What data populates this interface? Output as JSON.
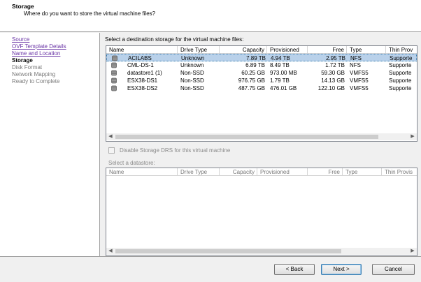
{
  "header": {
    "title": "Storage",
    "subtitle": "Where do you want to store the virtual machine files?"
  },
  "nav": {
    "items": [
      {
        "label": "Source",
        "state": "link"
      },
      {
        "label": "OVF Template Details",
        "state": "link"
      },
      {
        "label": "Name and Location",
        "state": "link"
      },
      {
        "label": "Storage",
        "state": "current"
      },
      {
        "label": "Disk Format",
        "state": "disabled"
      },
      {
        "label": "Network Mapping",
        "state": "disabled"
      },
      {
        "label": "Ready to Complete",
        "state": "disabled"
      }
    ]
  },
  "main": {
    "prompt": "Select a destination storage for the virtual machine files:",
    "columns": [
      "Name",
      "Drive Type",
      "Capacity",
      "Provisioned",
      "Free",
      "Type",
      "Thin Prov"
    ],
    "rows": [
      {
        "name": "ACILABS",
        "drive": "Unknown",
        "capacity": "7.89 TB",
        "provisioned": "4.94 TB",
        "free": "2.95 TB",
        "type": "NFS",
        "thin": "Supporte",
        "selected": true
      },
      {
        "name": "CML-DS-1",
        "drive": "Unknown",
        "capacity": "6.89 TB",
        "provisioned": "8.49 TB",
        "free": "1.72 TB",
        "type": "NFS",
        "thin": "Supporte",
        "selected": false
      },
      {
        "name": "datastore1 (1)",
        "drive": "Non-SSD",
        "capacity": "60.25 GB",
        "provisioned": "973.00 MB",
        "free": "59.30 GB",
        "type": "VMFS5",
        "thin": "Supporte",
        "selected": false
      },
      {
        "name": "ESX38-DS1",
        "drive": "Non-SSD",
        "capacity": "976.75 GB",
        "provisioned": "1.79 TB",
        "free": "14.13 GB",
        "type": "VMFS5",
        "thin": "Supporte",
        "selected": false
      },
      {
        "name": "ESX38-DS2",
        "drive": "Non-SSD",
        "capacity": "487.75 GB",
        "provisioned": "476.01 GB",
        "free": "122.10 GB",
        "type": "VMFS5",
        "thin": "Supporte",
        "selected": false
      }
    ],
    "drs_checkbox_label": "Disable Storage DRS for this virtual machine",
    "drs_checked": false,
    "datastore_label": "Select a datastore:",
    "datastore_columns": [
      "Name",
      "Drive Type",
      "Capacity",
      "Provisioned",
      "Free",
      "Type",
      "Thin Provis"
    ]
  },
  "footer": {
    "back": "< Back",
    "next": "Next >",
    "cancel": "Cancel"
  },
  "icons": {
    "datastore": "datastore-icon",
    "scroll_left": "scroll-left-icon",
    "scroll_right": "scroll-right-icon"
  },
  "colors": {
    "selection": "#b9d1ea",
    "link": "#6a35a6"
  }
}
